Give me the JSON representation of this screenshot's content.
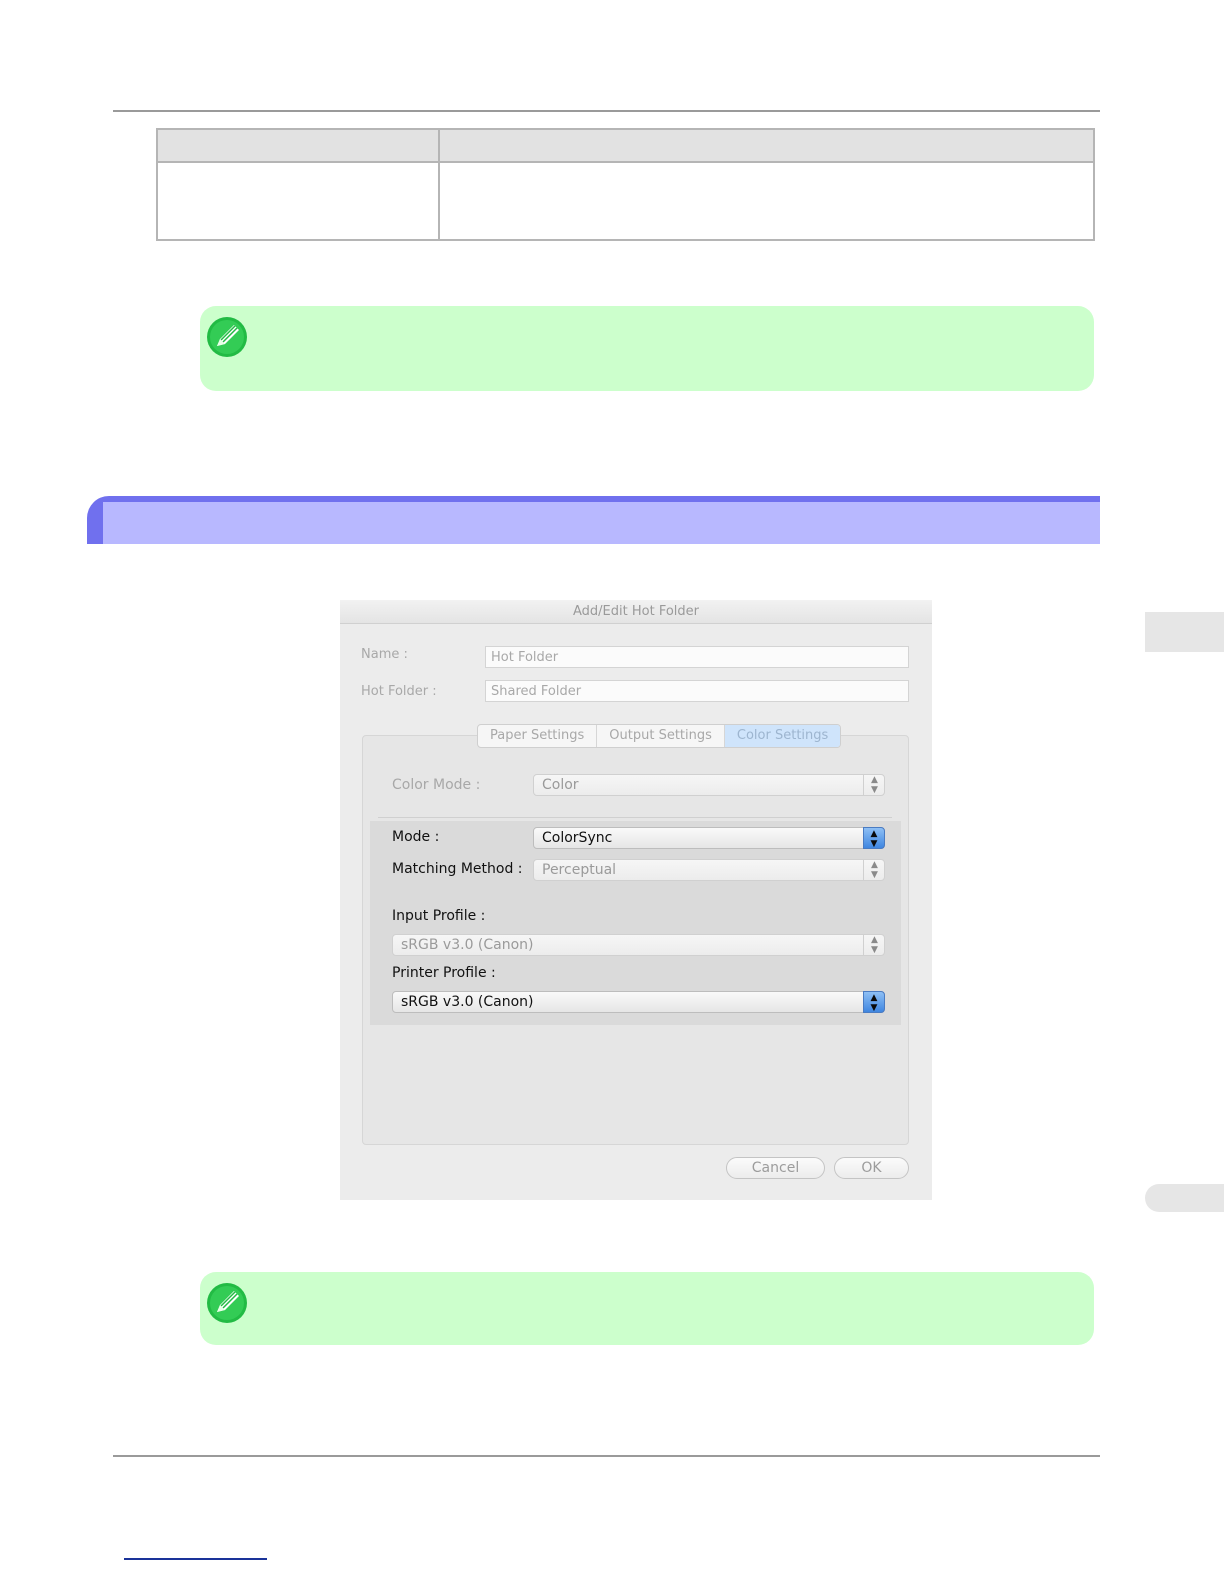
{
  "dialog": {
    "title": "Add/Edit Hot Folder",
    "name_label": "Name :",
    "name_value": "Hot Folder",
    "hot_folder_label": "Hot Folder :",
    "hot_folder_value": "Shared Folder",
    "tabs": [
      {
        "label": "Paper Settings",
        "active": false
      },
      {
        "label": "Output Settings",
        "active": false
      },
      {
        "label": "Color Settings",
        "active": true
      }
    ],
    "color_mode_label": "Color Mode :",
    "color_mode_value": "Color",
    "mode_label": "Mode :",
    "mode_value": "ColorSync",
    "matching_method_label": "Matching Method :",
    "matching_method_value": "Perceptual",
    "input_profile_label": "Input Profile :",
    "input_profile_value": "sRGB v3.0 (Canon)",
    "printer_profile_label": "Printer Profile :",
    "printer_profile_value": "sRGB v3.0 (Canon)",
    "cancel_label": "Cancel",
    "ok_label": "OK",
    "popup_arrows": "▲▼"
  },
  "colors": {
    "note_bg": "#ccffcc",
    "section_bar": "#7070ee",
    "section_bar_inner": "#b8b8ff",
    "selected_tab": "#cfe4fb",
    "popup_active": "#3f86e0"
  },
  "icons": {
    "note": "pencil-note-icon"
  }
}
